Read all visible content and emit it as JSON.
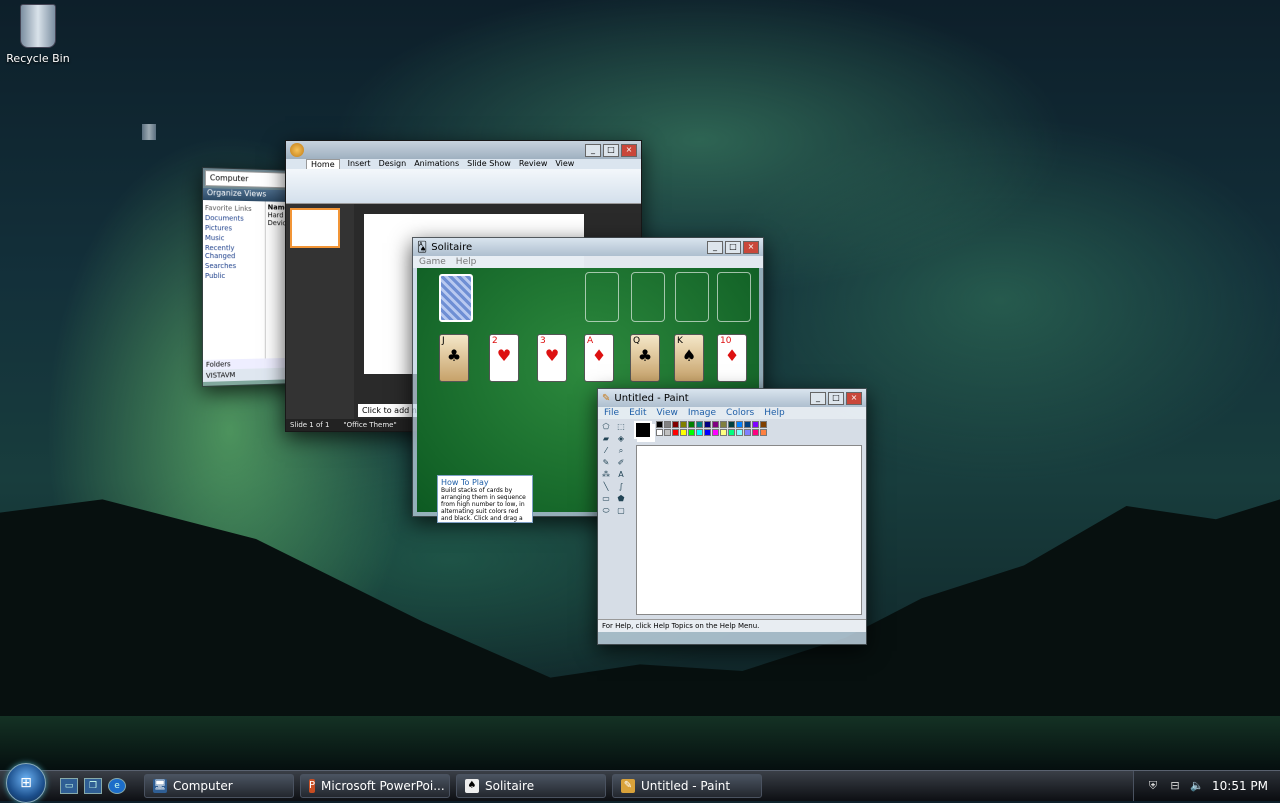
{
  "desktop": {
    "recycle_bin_label": "Recycle Bin"
  },
  "explorer": {
    "address": "Computer",
    "toolbar": "Organize  Views",
    "nav_header": "Favorite Links",
    "nav_items": [
      "Documents",
      "Pictures",
      "Music",
      "Recently Changed",
      "Searches",
      "Public"
    ],
    "list_header": "Name",
    "list_items": [
      "Hard Disk",
      "Devices"
    ],
    "folders_label": "Folders",
    "computer_name": "VISTAVM"
  },
  "powerpoint": {
    "tabs": [
      "Home",
      "Insert",
      "Design",
      "Animations",
      "Slide Show",
      "Review",
      "View"
    ],
    "notes_placeholder": "Click to add notes",
    "status_slide": "Slide 1 of 1",
    "status_theme": "\"Office Theme\""
  },
  "solitaire": {
    "title": "Solitaire",
    "menu": [
      "Game",
      "Help"
    ],
    "tableau": [
      {
        "rank": "J",
        "suit": "♣",
        "red": false,
        "face": true
      },
      {
        "rank": "2",
        "suit": "♥",
        "red": true,
        "face": false
      },
      {
        "rank": "3",
        "suit": "♥",
        "red": true,
        "face": false
      },
      {
        "rank": "A",
        "suit": "♦",
        "red": true,
        "face": false
      },
      {
        "rank": "Q",
        "suit": "♣",
        "red": false,
        "face": true
      },
      {
        "rank": "K",
        "suit": "♠",
        "red": false,
        "face": true
      },
      {
        "rank": "10",
        "suit": "♦",
        "red": true,
        "face": false
      }
    ],
    "howto_title": "How To Play",
    "howto_text": "Build stacks of cards by arranging them in sequence from high number to low, in alternating suit colors red and black. Click and drag a card to move it."
  },
  "paint": {
    "title": "Untitled - Paint",
    "menu": [
      "File",
      "Edit",
      "View",
      "Image",
      "Colors",
      "Help"
    ],
    "status": "For Help, click Help Topics on the Help Menu.",
    "palette": [
      "#000000",
      "#808080",
      "#800000",
      "#808000",
      "#008000",
      "#008080",
      "#000080",
      "#800080",
      "#808040",
      "#004040",
      "#0080ff",
      "#004080",
      "#8000ff",
      "#804000",
      "#ffffff",
      "#c0c0c0",
      "#ff0000",
      "#ffff00",
      "#00ff00",
      "#00ffff",
      "#0000ff",
      "#ff00ff",
      "#ffff80",
      "#00ff80",
      "#80ffff",
      "#8080ff",
      "#ff0080",
      "#ff8040"
    ]
  },
  "taskbar": {
    "buttons": [
      {
        "label": "Computer",
        "icon": "computer-icon",
        "glyph": "🖥",
        "color": "#2f5e94"
      },
      {
        "label": "Microsoft PowerPoi...",
        "icon": "powerpoint-icon",
        "glyph": "P",
        "color": "#c84d22"
      },
      {
        "label": "Solitaire",
        "icon": "solitaire-icon",
        "glyph": "♠",
        "color": "#eeeeee"
      },
      {
        "label": "Untitled - Paint",
        "icon": "paint-icon",
        "glyph": "✎",
        "color": "#d9a23a"
      }
    ],
    "clock": "10:51 PM"
  }
}
